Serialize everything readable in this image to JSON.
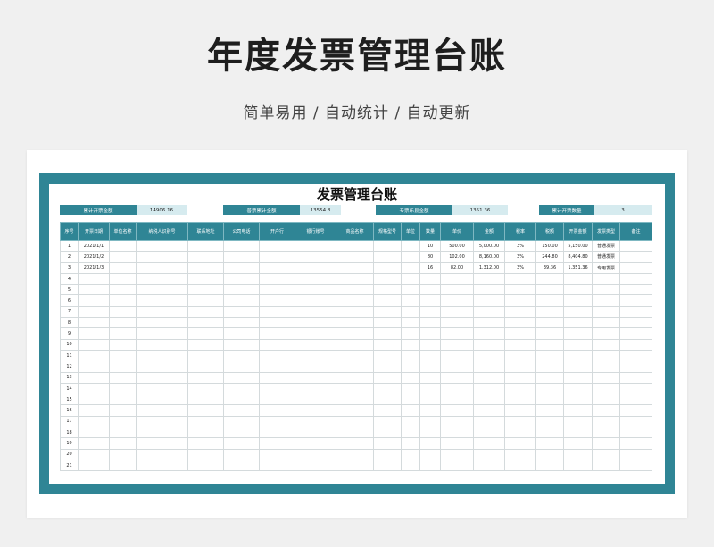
{
  "page": {
    "title": "年度发票管理台账",
    "subtitle": "简单易用 / 自动统计 / 自动更新"
  },
  "ledger": {
    "title": "发票管理台账",
    "summary": [
      {
        "label": "累计开票金额",
        "value": "14906.16"
      },
      {
        "label": "普票累计金额",
        "value": "13554.8"
      },
      {
        "label": "专票乐县金额",
        "value": "1351.36"
      },
      {
        "label": "累计开票数量",
        "value": "3"
      }
    ],
    "columns": [
      "序号",
      "开票日期",
      "单位名称",
      "纳税人识别号",
      "联系地址",
      "公司电话",
      "开户行",
      "银行账号",
      "商品名称",
      "规格型号",
      "单位",
      "数量",
      "单价",
      "金额",
      "税率",
      "税额",
      "开票金额",
      "发票类型",
      "备注"
    ],
    "rows": [
      [
        "1",
        "2021/1/1",
        "",
        "",
        "",
        "",
        "",
        "",
        "",
        "",
        "",
        "10",
        "500.00",
        "5,000.00",
        "3%",
        "150.00",
        "5,150.00",
        "普通发票",
        ""
      ],
      [
        "2",
        "2021/1/2",
        "",
        "",
        "",
        "",
        "",
        "",
        "",
        "",
        "",
        "80",
        "102.00",
        "8,160.00",
        "3%",
        "244.80",
        "8,404.80",
        "普通发票",
        ""
      ],
      [
        "3",
        "2021/1/3",
        "",
        "",
        "",
        "",
        "",
        "",
        "",
        "",
        "",
        "16",
        "82.00",
        "1,312.00",
        "3%",
        "39.36",
        "1,351.36",
        "专用发票",
        ""
      ],
      [
        "4"
      ],
      [
        "5"
      ],
      [
        "6"
      ],
      [
        "7"
      ],
      [
        "8"
      ],
      [
        "9"
      ],
      [
        "10"
      ],
      [
        "11"
      ],
      [
        "12"
      ],
      [
        "13"
      ],
      [
        "14"
      ],
      [
        "15"
      ],
      [
        "16"
      ],
      [
        "17"
      ],
      [
        "18"
      ],
      [
        "19"
      ],
      [
        "20"
      ],
      [
        "21"
      ]
    ]
  }
}
